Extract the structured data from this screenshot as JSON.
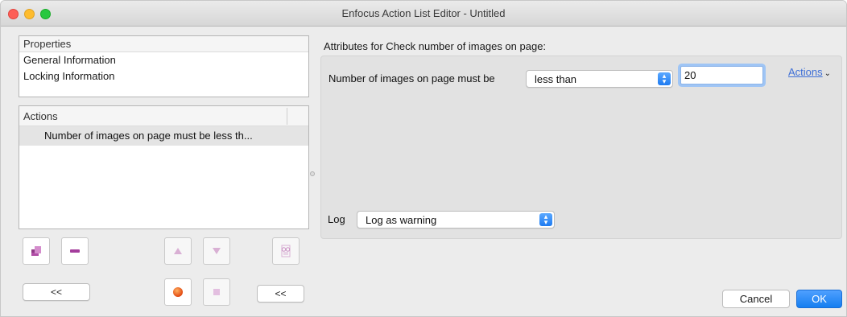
{
  "window": {
    "title": "Enfocus Action List Editor - Untitled"
  },
  "properties": {
    "header": "Properties",
    "items": [
      "General Information",
      "Locking Information"
    ]
  },
  "actions_list": {
    "header": "Actions",
    "rows": [
      "Number of images on page must be less th..."
    ]
  },
  "nav": {
    "left_collapse": "<<",
    "right_collapse": "<<"
  },
  "attributes": {
    "title": "Attributes for Check number of images on page:",
    "condition_label": "Number of images on page must be",
    "comparison_value": "less than",
    "count_value": "20",
    "actions_menu": "Actions",
    "log_label": "Log",
    "log_value": "Log as warning"
  },
  "footer": {
    "cancel": "Cancel",
    "ok": "OK"
  },
  "colors": {
    "accent": "#1e7bf1",
    "link": "#3e6fd6",
    "selected_row": "#e4e4e4"
  },
  "icons": {
    "add_action": "add-action-icon",
    "remove_action": "remove-action-icon",
    "move_up": "triangle-up-icon",
    "move_down": "triangle-down-icon",
    "preview": "glasses-document-icon",
    "record": "record-dot-icon",
    "stop": "stop-square-icon"
  }
}
